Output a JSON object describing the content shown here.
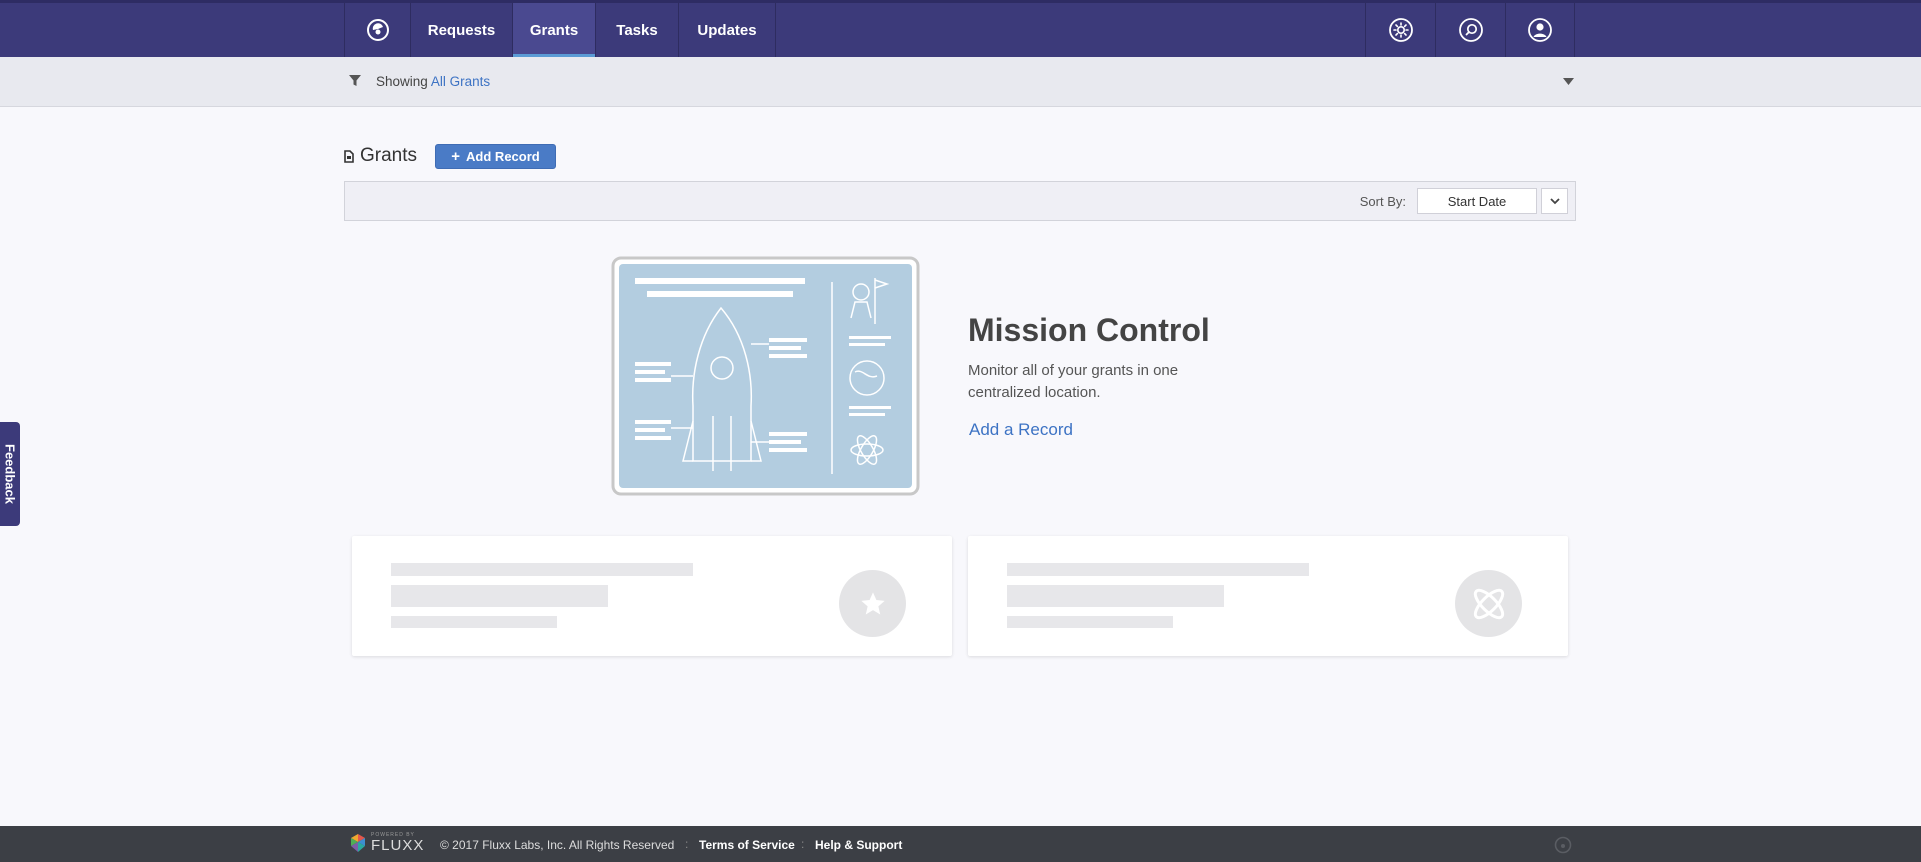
{
  "nav": {
    "tabs": [
      {
        "label": "Requests"
      },
      {
        "label": "Grants",
        "active": true
      },
      {
        "label": "Tasks"
      },
      {
        "label": "Updates"
      }
    ],
    "right_icons": [
      "settings-icon",
      "search-icon",
      "user-icon"
    ]
  },
  "filter": {
    "prefix": "Showing",
    "value": "All Grants"
  },
  "grants": {
    "title": "Grants",
    "add_button": "Add Record",
    "add_button_icon": "+"
  },
  "sort": {
    "label": "Sort By:",
    "selected": "Start Date"
  },
  "hero": {
    "title": "Mission Control",
    "description": "Monitor all of your grants in one centralized location.",
    "link": "Add a Record"
  },
  "cards": [
    {
      "icon": "star-icon"
    },
    {
      "icon": "atom-icon"
    }
  ],
  "feedback": {
    "label": "Feedback"
  },
  "footer": {
    "brand_small": "POWERED BY",
    "brand": "FLUXX",
    "copyright": "© 2017 Fluxx Labs, Inc. All Rights Reserved",
    "links": [
      {
        "label": "Terms of Service"
      },
      {
        "label": "Help & Support"
      }
    ]
  },
  "colors": {
    "nav_bg": "#3c3a7a",
    "accent": "#4a7bc6",
    "link": "#3d73c4",
    "footer_bg": "#3c3f45",
    "illustration_bg": "#b3cde0"
  }
}
